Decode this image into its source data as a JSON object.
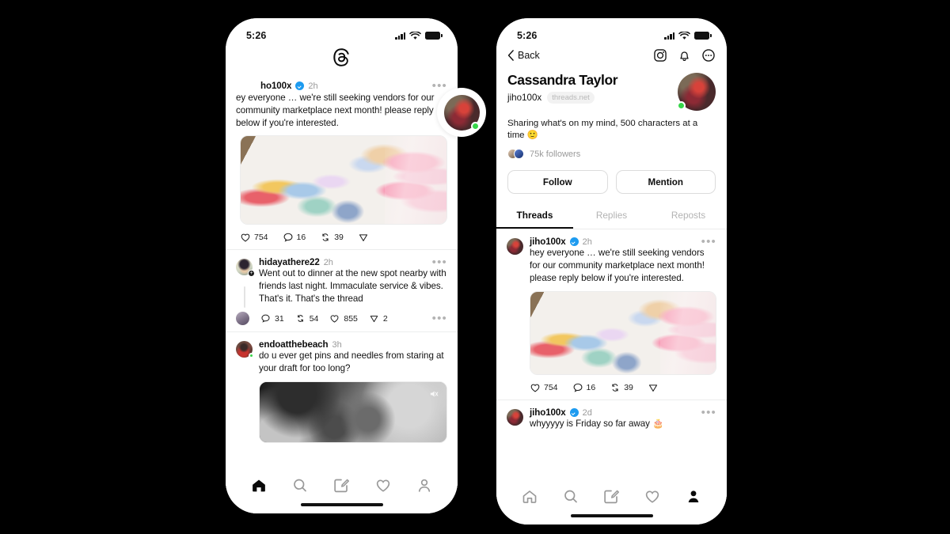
{
  "scene": {
    "background_color": "#000000",
    "accent_verified": "#1d9bf0",
    "online_dot_color": "#37d64a"
  },
  "left_phone": {
    "status_bar": {
      "time": "5:26",
      "signal_icon": "cellular-bars-icon",
      "wifi_icon": "wifi-icon",
      "battery_icon": "battery-icon"
    },
    "app_logo": "threads-logo-icon",
    "floating_avatar": {
      "name": "jiho100x-floating-avatar",
      "online": true
    },
    "feed": [
      {
        "username": "ho100x",
        "verified": true,
        "timestamp": "2h",
        "text": "ey everyone … we're still seeking vendors for our community marketplace next month! please reply below if you're interested.",
        "media": "sticker-desk-photo",
        "actions": {
          "like": "754",
          "reply": "16",
          "repost": "39",
          "share": ""
        }
      },
      {
        "username": "hidayathere22",
        "verified": false,
        "timestamp": "2h",
        "text": "Went out to dinner at the new spot nearby with friends last night. Immaculate service & vibes. That's it. That's the thread",
        "media": null,
        "reply_actions": {
          "reply": "31",
          "repost": "54",
          "like": "855",
          "share": "2"
        }
      },
      {
        "username": "endoatthebeach",
        "verified": false,
        "timestamp": "3h",
        "text": "do u ever get pins and needles from staring at your draft for too long?",
        "media": "moon-video",
        "media_badge": "mute-icon"
      }
    ],
    "tab_bar": [
      {
        "icon": "home-icon",
        "active": true
      },
      {
        "icon": "search-icon",
        "active": false
      },
      {
        "icon": "compose-icon",
        "active": false
      },
      {
        "icon": "heart-icon",
        "active": false
      },
      {
        "icon": "profile-icon",
        "active": false
      }
    ]
  },
  "right_phone": {
    "status_bar": {
      "time": "5:26",
      "signal_icon": "cellular-bars-icon",
      "wifi_icon": "wifi-icon",
      "battery_icon": "battery-icon"
    },
    "nav": {
      "back_label": "Back",
      "back_icon": "chevron-left-icon",
      "icons": [
        "instagram-icon",
        "bell-icon",
        "more-circle-icon"
      ]
    },
    "profile": {
      "display_name": "Cassandra Taylor",
      "handle": "jiho100x",
      "domain_chip": "threads.net",
      "bio": "Sharing what's on my mind, 500 characters at a time 🙂",
      "followers": "75k followers",
      "avatar_online": true
    },
    "buttons": {
      "follow": "Follow",
      "mention": "Mention"
    },
    "tabs": [
      {
        "label": "Threads",
        "active": true
      },
      {
        "label": "Replies",
        "active": false
      },
      {
        "label": "Reposts",
        "active": false
      }
    ],
    "feed": [
      {
        "username": "jiho100x",
        "verified": true,
        "timestamp": "2h",
        "text": "hey everyone … we're still seeking vendors for our community marketplace next month! please reply below if you're interested.",
        "media": "sticker-desk-photo",
        "actions": {
          "like": "754",
          "reply": "16",
          "repost": "39",
          "share": ""
        }
      },
      {
        "username": "jiho100x",
        "verified": true,
        "timestamp": "2d",
        "text": "whyyyyy is Friday so far away 🎂",
        "media": null
      }
    ],
    "tab_bar": [
      {
        "icon": "home-icon",
        "active": false
      },
      {
        "icon": "search-icon",
        "active": false
      },
      {
        "icon": "compose-icon",
        "active": false
      },
      {
        "icon": "heart-icon",
        "active": false
      },
      {
        "icon": "profile-icon",
        "active": true
      }
    ]
  }
}
